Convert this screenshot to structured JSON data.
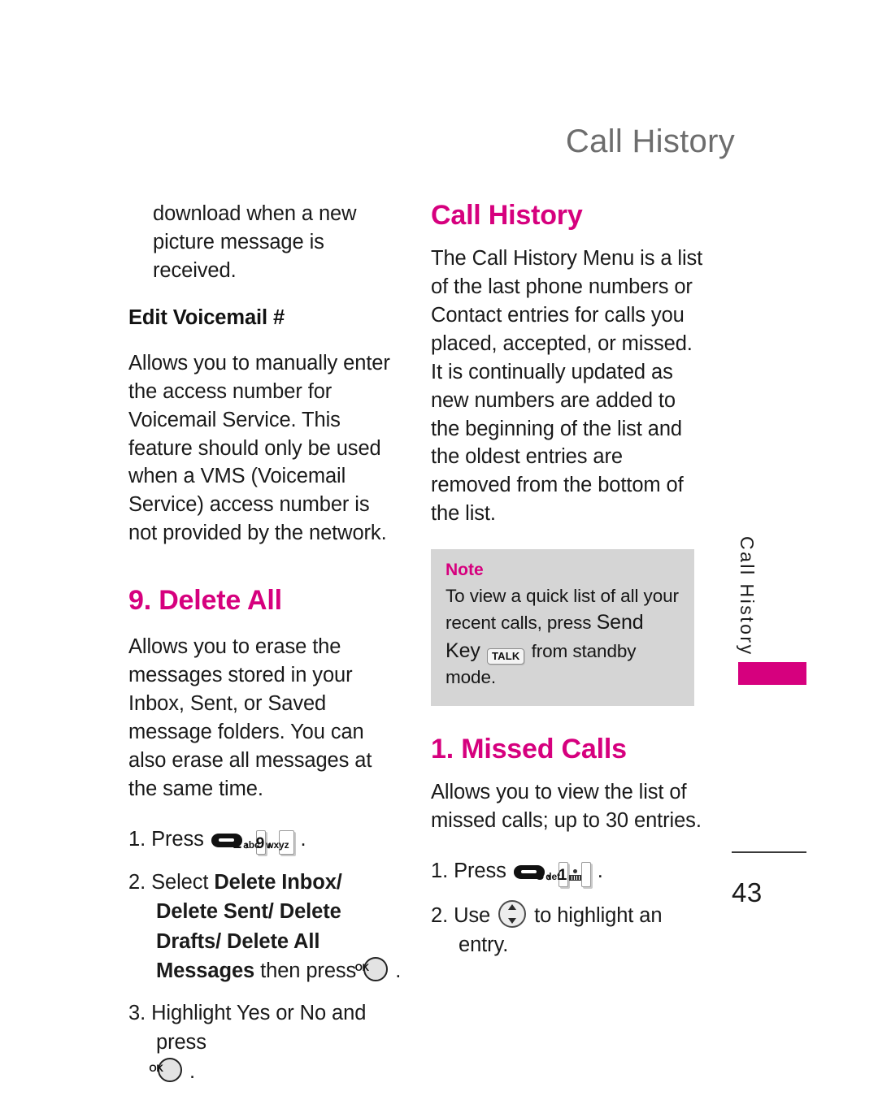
{
  "page": {
    "running_header": "Call History",
    "page_number": "43",
    "accent_color": "#D6007E",
    "header_color": "#6D6D6D",
    "note_bg_color": "#D5D5D5"
  },
  "side_tab": {
    "label": "Call History"
  },
  "left_column": {
    "continued_paragraph": "download when a new picture message is received.",
    "subhead": "Edit Voicemail #",
    "subhead_paragraph": "Allows you to manually enter the access number for Voicemail Service. This feature should only be used when a VMS (Voicemail Service) access number is not provided by the network.",
    "section_heading": "9. Delete All",
    "section_paragraph": "Allows you to erase the messages stored in your Inbox, Sent, or Saved message folders. You can also erase all messages at the same time.",
    "steps": [
      {
        "number": "1.",
        "text_before": "Press",
        "keys": [
          "menu-key",
          "2-abc-key",
          "9-wxyz-key"
        ],
        "text_after": "."
      },
      {
        "number": "2.",
        "text_before": "Select",
        "bold_text": "Delete Inbox/ Delete Sent/ Delete Drafts/ Delete All Messages",
        "text_middle": "then press",
        "keys": [
          "ok-key"
        ],
        "text_after": "."
      },
      {
        "number": "3.",
        "text_before": "Highlight Yes or No and press",
        "keys": [
          "ok-key"
        ],
        "text_after": "."
      }
    ]
  },
  "right_column": {
    "section_heading": "Call History",
    "intro_paragraph": "The Call History Menu is a list of the last phone numbers or Contact entries for calls you placed, accepted, or missed. It is continually updated as new numbers are added to the beginning of the list and the oldest entries are removed from the bottom of the list.",
    "note": {
      "title": "Note",
      "text_before": "To view a quick list of all your recent calls, press",
      "send_key_label": "Send Key",
      "talk_key_label": "TALK",
      "text_after": "from standby mode."
    },
    "subsection_heading": "1. Missed Calls",
    "subsection_paragraph": "Allows you to view the list of missed calls; up to 30 entries.",
    "steps": [
      {
        "number": "1.",
        "text_before": "Press",
        "keys": [
          "menu-key",
          "3-def-key",
          "1-voicemail-key"
        ],
        "text_after": "."
      },
      {
        "number": "2.",
        "text_before": "Use",
        "keys": [
          "nav-key"
        ],
        "text_after": "to highlight an entry."
      }
    ]
  },
  "keycaps": {
    "two": {
      "digit": "2",
      "letters": "abc"
    },
    "nine": {
      "digit": "9",
      "letters": "wxyz"
    },
    "three": {
      "digit": "3",
      "letters": "def"
    },
    "one": {
      "digit": "1",
      "letters": ""
    },
    "ok": {
      "label": "OK"
    },
    "talk": {
      "label": "TALK"
    }
  }
}
